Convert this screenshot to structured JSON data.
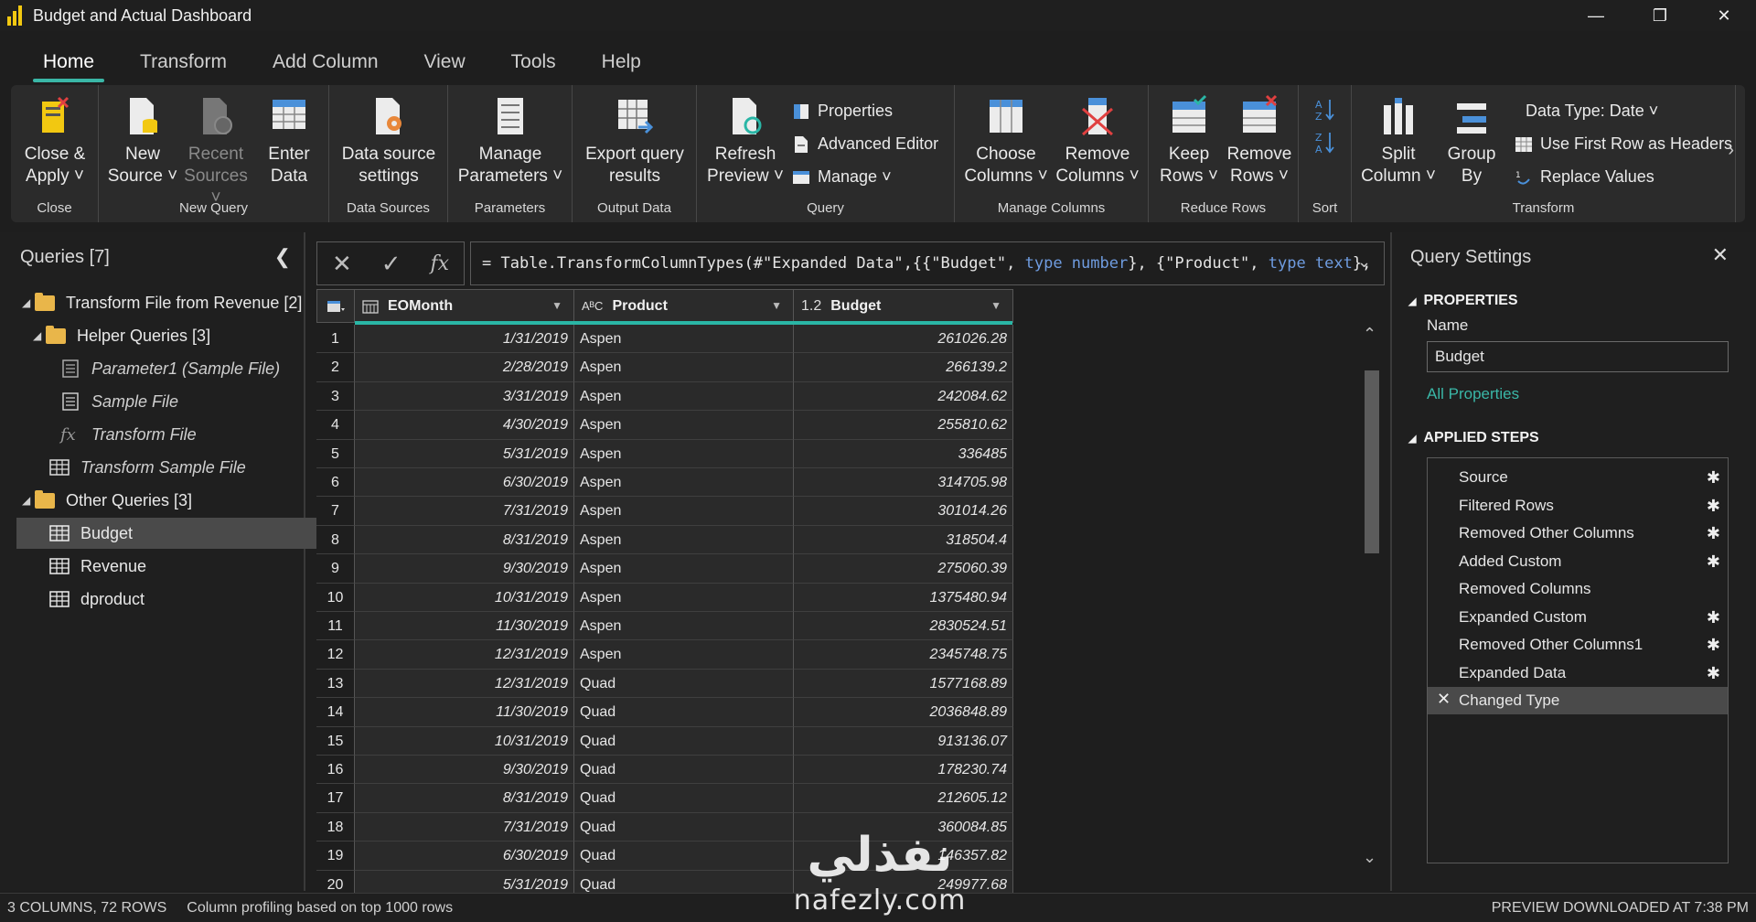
{
  "window": {
    "title": "Budget and Actual Dashboard"
  },
  "tabs": [
    "Home",
    "Transform",
    "Add Column",
    "View",
    "Tools",
    "Help"
  ],
  "ribbon": {
    "close": {
      "label": "Close",
      "close_apply_l1": "Close &",
      "close_apply_l2": "Apply"
    },
    "new_query": {
      "label": "New Query",
      "new_source_l1": "New",
      "new_source_l2": "Source",
      "recent_l1": "Recent",
      "recent_l2": "Sources",
      "enter_l1": "Enter",
      "enter_l2": "Data"
    },
    "data_sources": {
      "label": "Data Sources",
      "settings_l1": "Data source",
      "settings_l2": "settings"
    },
    "parameters": {
      "label": "Parameters",
      "manage_l1": "Manage",
      "manage_l2": "Parameters"
    },
    "output_data": {
      "label": "Output Data",
      "export_l1": "Export query",
      "export_l2": "results"
    },
    "query": {
      "label": "Query",
      "refresh_l1": "Refresh",
      "refresh_l2": "Preview",
      "properties": "Properties",
      "advanced_editor": "Advanced Editor",
      "manage": "Manage"
    },
    "manage_columns": {
      "label": "Manage Columns",
      "choose_l1": "Choose",
      "choose_l2": "Columns",
      "remove_l1": "Remove",
      "remove_l2": "Columns"
    },
    "reduce_rows": {
      "label": "Reduce Rows",
      "keep_l1": "Keep",
      "keep_l2": "Rows",
      "remove_l1": "Remove",
      "remove_l2": "Rows"
    },
    "sort": {
      "label": "Sort"
    },
    "transform": {
      "label": "Transform",
      "split_l1": "Split",
      "split_l2": "Column",
      "group_l1": "Group",
      "group_l2": "By",
      "data_type": "Data Type: Date",
      "first_row": "Use First Row as Headers",
      "replace": "Replace Values"
    }
  },
  "queries_pane": {
    "title": "Queries [7]",
    "items": [
      {
        "label": "Transform File from Revenue [2]"
      },
      {
        "label": "Helper Queries [3]"
      },
      {
        "label": "Parameter1 (Sample File)"
      },
      {
        "label": "Sample File"
      },
      {
        "label": "Transform File"
      },
      {
        "label": "Transform Sample File"
      },
      {
        "label": "Other Queries [3]"
      },
      {
        "label": "Budget"
      },
      {
        "label": "Revenue"
      },
      {
        "label": "dproduct"
      }
    ]
  },
  "formula_bar": {
    "fx": "fx",
    "p1": "= Table.TransformColumnTypes(#\"Expanded Data\",{{\"Budget\", ",
    "k1": "type number",
    "p2": "}, {\"Product\", ",
    "k2": "type text",
    "p3": "},"
  },
  "grid": {
    "columns": [
      {
        "type": "",
        "name": "EOMonth"
      },
      {
        "type": "AᴮC",
        "name": "Product"
      },
      {
        "type": "1.2",
        "name": "Budget"
      }
    ],
    "rows": [
      [
        "1",
        "1/31/2019",
        "Aspen",
        "261026.28"
      ],
      [
        "2",
        "2/28/2019",
        "Aspen",
        "266139.2"
      ],
      [
        "3",
        "3/31/2019",
        "Aspen",
        "242084.62"
      ],
      [
        "4",
        "4/30/2019",
        "Aspen",
        "255810.62"
      ],
      [
        "5",
        "5/31/2019",
        "Aspen",
        "336485"
      ],
      [
        "6",
        "6/30/2019",
        "Aspen",
        "314705.98"
      ],
      [
        "7",
        "7/31/2019",
        "Aspen",
        "301014.26"
      ],
      [
        "8",
        "8/31/2019",
        "Aspen",
        "318504.4"
      ],
      [
        "9",
        "9/30/2019",
        "Aspen",
        "275060.39"
      ],
      [
        "10",
        "10/31/2019",
        "Aspen",
        "1375480.94"
      ],
      [
        "11",
        "11/30/2019",
        "Aspen",
        "2830524.51"
      ],
      [
        "12",
        "12/31/2019",
        "Aspen",
        "2345748.75"
      ],
      [
        "13",
        "12/31/2019",
        "Quad",
        "1577168.89"
      ],
      [
        "14",
        "11/30/2019",
        "Quad",
        "2036848.89"
      ],
      [
        "15",
        "10/31/2019",
        "Quad",
        "913136.07"
      ],
      [
        "16",
        "9/30/2019",
        "Quad",
        "178230.74"
      ],
      [
        "17",
        "8/31/2019",
        "Quad",
        "212605.12"
      ],
      [
        "18",
        "7/31/2019",
        "Quad",
        "360084.85"
      ],
      [
        "19",
        "6/30/2019",
        "Quad",
        "146357.82"
      ],
      [
        "20",
        "5/31/2019",
        "Quad",
        "249977.68"
      ]
    ]
  },
  "query_settings": {
    "title": "Query Settings",
    "properties_header": "PROPERTIES",
    "name_label": "Name",
    "name_value": "Budget",
    "all_properties": "All Properties",
    "steps_header": "APPLIED STEPS",
    "steps": [
      {
        "label": "Source",
        "gear": true
      },
      {
        "label": "Filtered Rows",
        "gear": true
      },
      {
        "label": "Removed Other Columns",
        "gear": true
      },
      {
        "label": "Added Custom",
        "gear": true
      },
      {
        "label": "Removed Columns",
        "gear": false
      },
      {
        "label": "Expanded Custom",
        "gear": true
      },
      {
        "label": "Removed Other Columns1",
        "gear": true
      },
      {
        "label": "Expanded Data",
        "gear": true
      },
      {
        "label": "Changed Type",
        "gear": false,
        "selected": true
      }
    ]
  },
  "status": {
    "shape": "3 COLUMNS, 72 ROWS",
    "profiling": "Column profiling based on top 1000 rows",
    "preview": "PREVIEW DOWNLOADED AT 7:38 PM"
  },
  "watermark": {
    "arabic": "نفذلي",
    "latin": "nafezly.com"
  },
  "colors": {
    "accent": "#3ab7a7",
    "background": "#1e1e1e",
    "powerbi_yellow": "#f2c811"
  }
}
